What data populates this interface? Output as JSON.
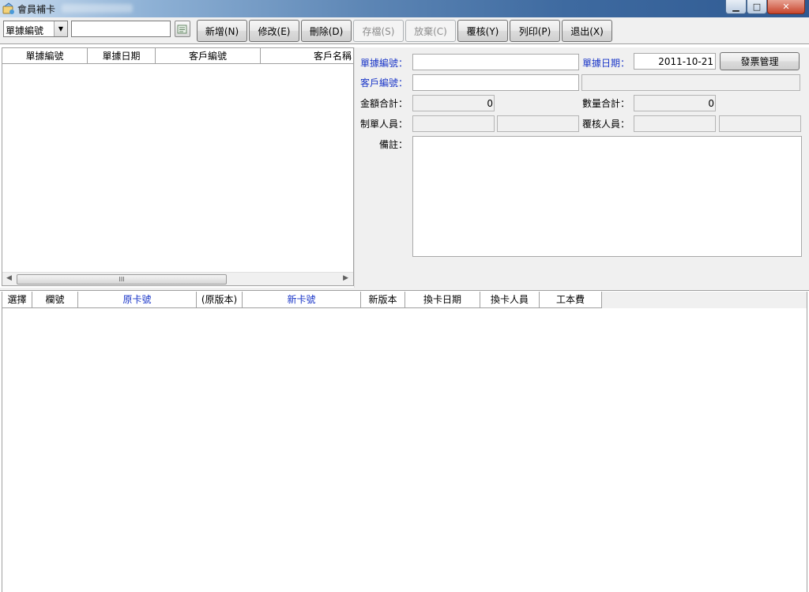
{
  "window": {
    "title": "會員補卡",
    "buttons": {
      "minimize": "▁",
      "maximize": "□",
      "close": "✕"
    }
  },
  "toolbar": {
    "field_combo": {
      "value": "單據編號"
    },
    "search_input": {
      "value": ""
    },
    "buttons": [
      {
        "label": "新增(N)",
        "enabled": true
      },
      {
        "label": "修改(E)",
        "enabled": true
      },
      {
        "label": "刪除(D)",
        "enabled": true
      },
      {
        "label": "存檔(S)",
        "enabled": false
      },
      {
        "label": "放棄(C)",
        "enabled": false
      },
      {
        "label": "覆核(Y)",
        "enabled": true
      },
      {
        "label": "列印(P)",
        "enabled": true
      },
      {
        "label": "退出(X)",
        "enabled": true
      }
    ]
  },
  "upper_list": {
    "columns": [
      "單據編號",
      "單據日期",
      "客戶編號",
      "客戶名稱"
    ],
    "rows": [],
    "scrollbar": {
      "thumb_label": "III"
    }
  },
  "form": {
    "doc_no": {
      "label": "單據編號：",
      "value": ""
    },
    "doc_date": {
      "label": "單據日期：",
      "value": "2011-10-21"
    },
    "invoice_button": "發票管理",
    "customer_no": {
      "label": "客戶編號：",
      "value": "",
      "name_value": ""
    },
    "amount_total": {
      "label": "金額合計：",
      "value": "0"
    },
    "quantity_total": {
      "label": "數量合計：",
      "value": "0"
    },
    "creator": {
      "label": "制單人員：",
      "value": "",
      "value2": ""
    },
    "reviewer": {
      "label": "覆核人員：",
      "value": "",
      "value2": ""
    },
    "remark": {
      "label": "備註：",
      "value": ""
    }
  },
  "lower_grid": {
    "columns": [
      {
        "label": "選擇",
        "highlight": false
      },
      {
        "label": "欄號",
        "highlight": false
      },
      {
        "label": "原卡號",
        "highlight": true
      },
      {
        "label": "(原版本)",
        "highlight": false
      },
      {
        "label": "新卡號",
        "highlight": true
      },
      {
        "label": "新版本",
        "highlight": false
      },
      {
        "label": "換卡日期",
        "highlight": false
      },
      {
        "label": "換卡人員",
        "highlight": false
      },
      {
        "label": "工本費",
        "highlight": false
      }
    ],
    "rows": []
  },
  "colors": {
    "required_label": "#1a36c8",
    "panel_bg": "#f0f0f0"
  }
}
